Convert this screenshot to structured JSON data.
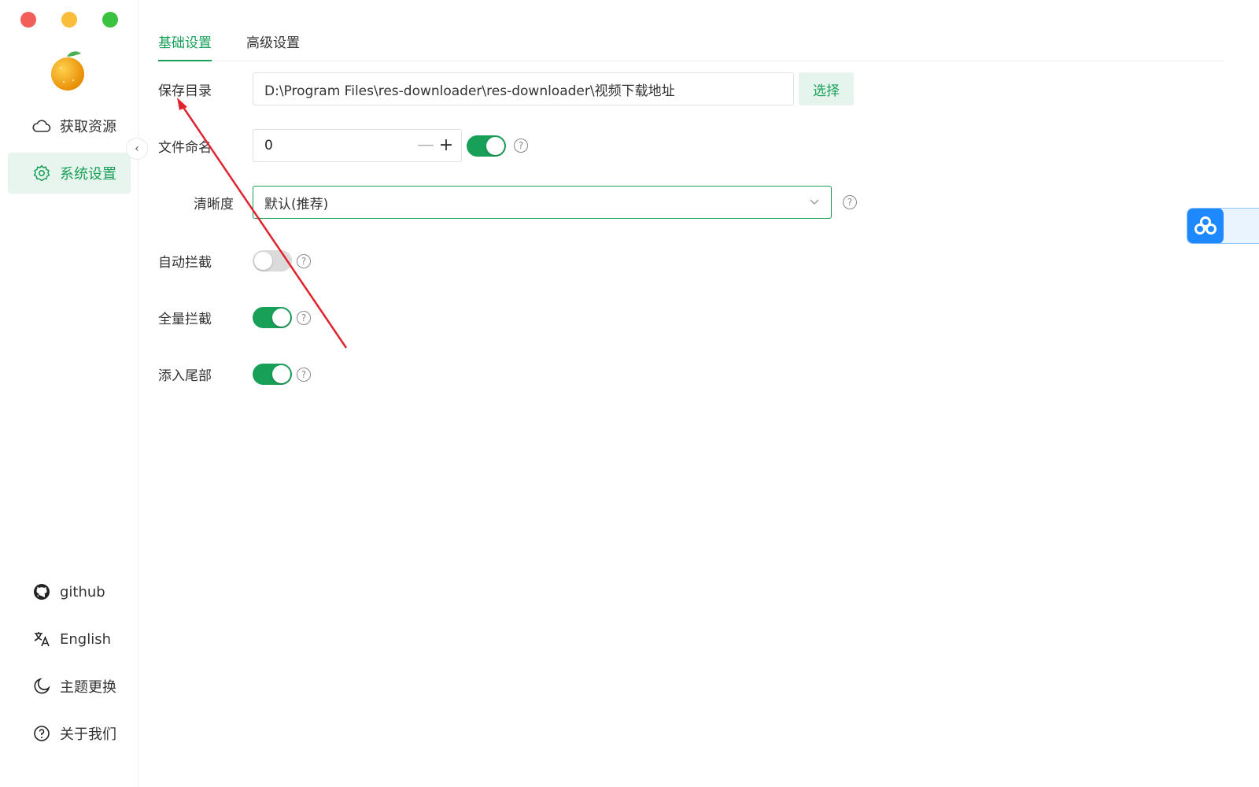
{
  "window": {
    "controls": [
      "close",
      "minimize",
      "maximize"
    ]
  },
  "sidebar": {
    "logo_icon": "orange-fruit-icon",
    "nav_items": [
      {
        "label": "获取资源",
        "icon": "cloud-icon",
        "active": false
      },
      {
        "label": "系统设置",
        "icon": "gear-icon",
        "active": true
      }
    ],
    "collapse_icon": "chevron-left-icon",
    "bottom_items": [
      {
        "label": "github",
        "icon": "github-icon"
      },
      {
        "label": "English",
        "icon": "translate-icon"
      },
      {
        "label": "主题更换",
        "icon": "moon-icon"
      },
      {
        "label": "关于我们",
        "icon": "help-circle-icon"
      }
    ]
  },
  "tabs": [
    {
      "label": "基础设置",
      "active": true
    },
    {
      "label": "高级设置",
      "active": false
    }
  ],
  "settings": {
    "save_dir": {
      "label": "保存目录",
      "value": "D:\\Program Files\\res-downloader\\res-downloader\\视频下载地址",
      "button": "选择"
    },
    "file_naming": {
      "label": "文件命名",
      "value": "0",
      "minus": "—",
      "plus": "+",
      "toggle_on": true
    },
    "quality": {
      "label": "清晰度",
      "value": "默认(推荐)"
    },
    "auto_intercept": {
      "label": "自动拦截",
      "toggle_on": false
    },
    "full_intercept": {
      "label": "全量拦截",
      "toggle_on": true
    },
    "append_tail": {
      "label": "添入尾部",
      "toggle_on": true
    }
  },
  "help_glyph": "?",
  "floating_widget": {
    "icon": "baidu-netdisk-icon"
  },
  "colors": {
    "accent": "#18a058",
    "accent_light": "#e8f5ee",
    "annotation_arrow": "#e0242e",
    "widget_blue": "#1e88ff"
  }
}
